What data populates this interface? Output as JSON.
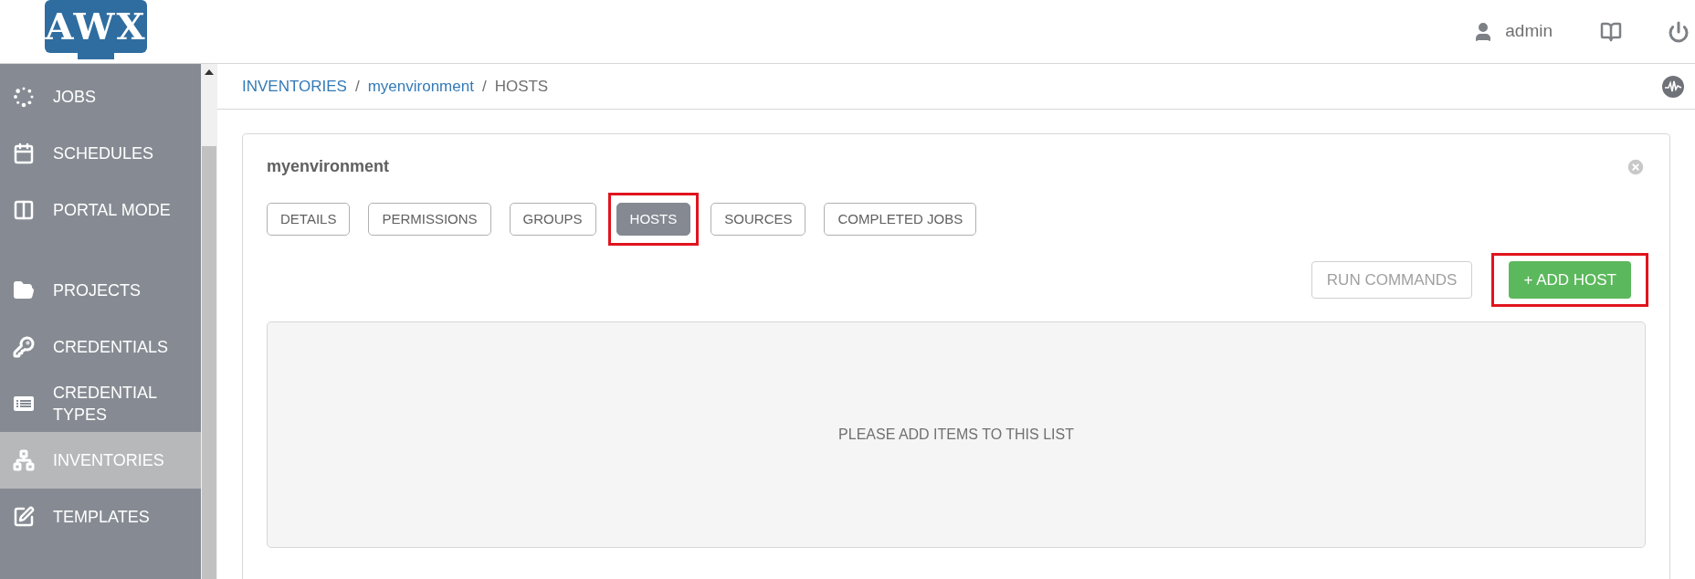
{
  "logo": {
    "text": "AWX"
  },
  "header": {
    "user": "admin"
  },
  "sidebar": {
    "groups": [
      [
        {
          "label": "JOBS",
          "kind": "dots",
          "selected": false
        },
        {
          "label": "SCHEDULES",
          "kind": "calendar",
          "selected": false
        },
        {
          "label": "PORTAL MODE",
          "kind": "columns",
          "selected": false
        }
      ],
      [
        {
          "label": "PROJECTS",
          "kind": "folder",
          "selected": false
        },
        {
          "label": "CREDENTIALS",
          "kind": "key",
          "selected": false
        },
        {
          "label": "CREDENTIAL TYPES",
          "kind": "list",
          "selected": false
        },
        {
          "label": "INVENTORIES",
          "kind": "sitemap",
          "selected": true
        },
        {
          "label": "TEMPLATES",
          "kind": "edit",
          "selected": false
        }
      ]
    ]
  },
  "breadcrumb": [
    {
      "text": "INVENTORIES",
      "kind": "link"
    },
    {
      "text": "/",
      "kind": "separator"
    },
    {
      "text": "myenvironment",
      "kind": "link"
    },
    {
      "text": "/",
      "kind": "separator"
    },
    {
      "text": "HOSTS",
      "kind": "current"
    }
  ],
  "card": {
    "title": "myenvironment",
    "tabs": [
      {
        "label": "DETAILS",
        "selected": false,
        "highlighted": false
      },
      {
        "label": "PERMISSIONS",
        "selected": false,
        "highlighted": false
      },
      {
        "label": "GROUPS",
        "selected": false,
        "highlighted": false
      },
      {
        "label": "HOSTS",
        "selected": true,
        "highlighted": true
      },
      {
        "label": "SOURCES",
        "selected": false,
        "highlighted": false
      },
      {
        "label": "COMPLETED JOBS",
        "selected": false,
        "highlighted": false
      }
    ],
    "actions": [
      {
        "label": "RUN COMMANDS",
        "kind": "outline",
        "highlighted": false
      },
      {
        "label": "+ ADD HOST",
        "kind": "primary",
        "highlighted": true
      }
    ],
    "empty_message": "PLEASE ADD ITEMS TO THIS LIST"
  }
}
